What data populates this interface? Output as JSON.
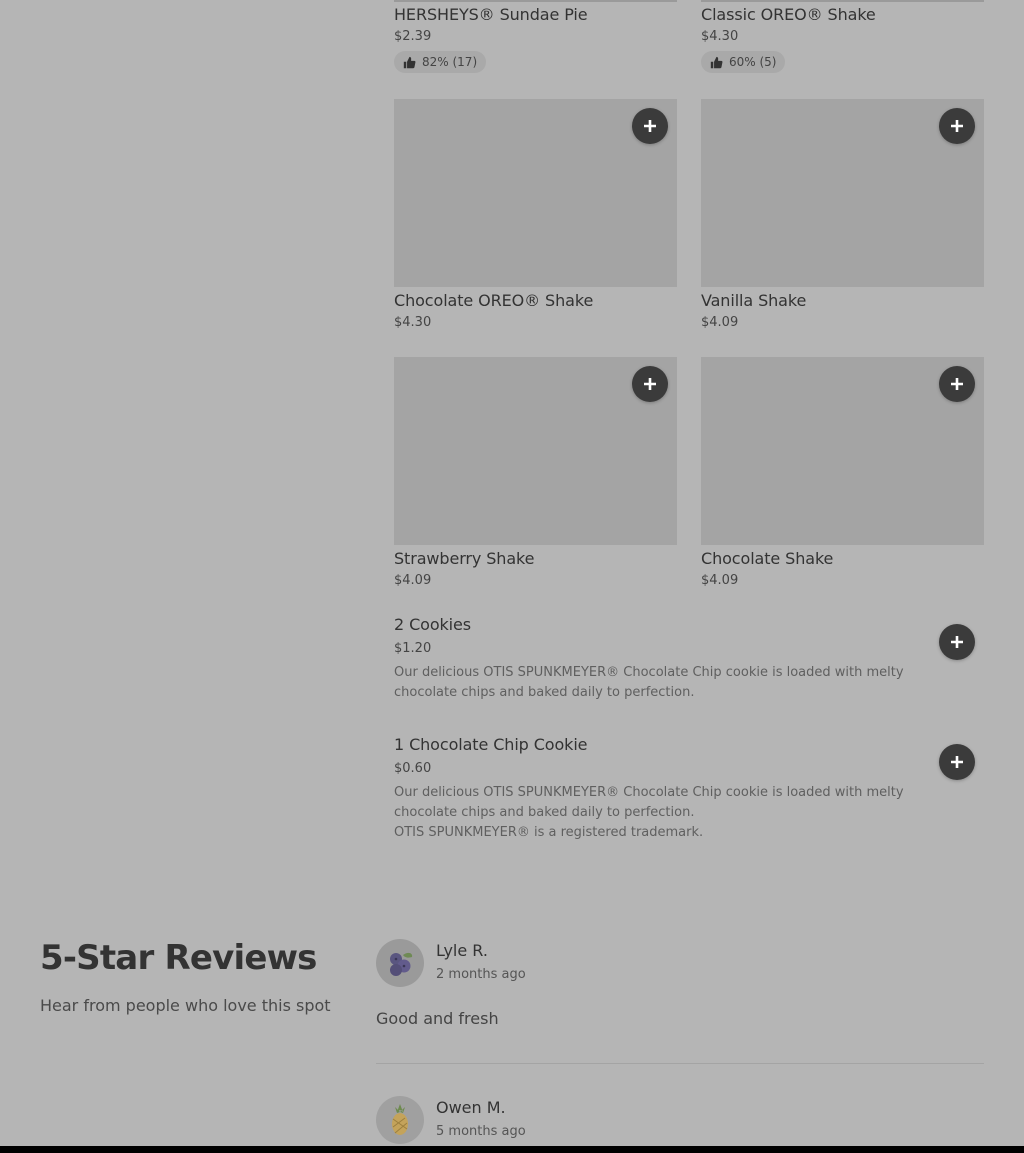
{
  "menu": {
    "items": [
      {
        "name": "HERSHEYS® Sundae Pie",
        "price": "$2.39",
        "rating": "82% (17)"
      },
      {
        "name": "Classic OREO® Shake",
        "price": "$4.30",
        "rating": "60% (5)"
      },
      {
        "name": "Chocolate OREO® Shake",
        "price": "$4.30"
      },
      {
        "name": "Vanilla Shake",
        "price": "$4.09"
      },
      {
        "name": "Strawberry Shake",
        "price": "$4.09"
      },
      {
        "name": "Chocolate Shake",
        "price": "$4.09"
      }
    ],
    "list_items": [
      {
        "name": "2 Cookies",
        "price": "$1.20",
        "desc": "Our delicious OTIS SPUNKMEYER® Chocolate Chip cookie is loaded with melty chocolate chips and baked daily to perfection."
      },
      {
        "name": "1 Chocolate Chip Cookie",
        "price": "$0.60",
        "desc": "Our delicious OTIS SPUNKMEYER® Chocolate Chip cookie is loaded with melty chocolate chips and baked daily to perfection.",
        "desc2": "OTIS SPUNKMEYER® is a registered trademark."
      }
    ],
    "icons": {
      "add": "plus-icon",
      "rating": "thumbs-up-icon"
    }
  },
  "reviews": {
    "title": "5-Star Reviews",
    "subtitle": "Hear from people who love this spot",
    "items": [
      {
        "name": "Lyle R.",
        "date": "2 months ago",
        "text": "Good and fresh",
        "avatar": "blueberries-icon"
      },
      {
        "name": "Owen M.",
        "date": "5 months ago",
        "avatar": "pineapple-icon"
      }
    ]
  },
  "colors": {
    "page_bg": "#b5b5b5",
    "button_bg": "#3b3b3b",
    "placeholder_image": "#a4a4a4"
  }
}
